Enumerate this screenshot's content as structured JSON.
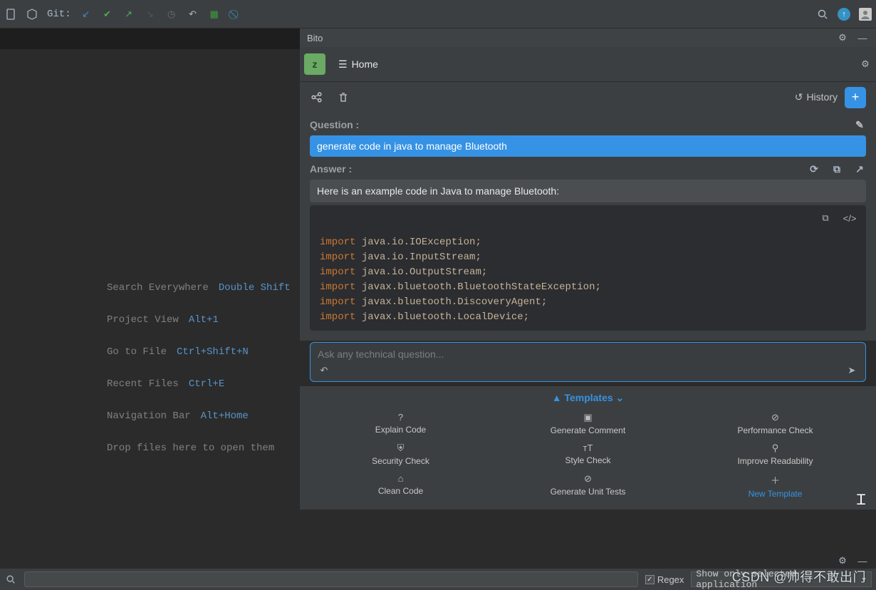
{
  "toolbar": {
    "git_label": "Git:"
  },
  "shortcuts": {
    "items": [
      {
        "label": "Search Everywhere",
        "key": "Double Shift"
      },
      {
        "label": "Project View",
        "key": "Alt+1"
      },
      {
        "label": "Go to File",
        "key": "Ctrl+Shift+N"
      },
      {
        "label": "Recent Files",
        "key": "Ctrl+E"
      },
      {
        "label": "Navigation Bar",
        "key": "Alt+Home"
      }
    ],
    "drop": "Drop files here to open them"
  },
  "bito": {
    "title": "Bito",
    "z": "z",
    "home": "Home",
    "history": "History",
    "question_hdr": "Question :",
    "question": "generate code in java to manage Bluetooth",
    "answer_hdr": "Answer :",
    "answer_intro": "Here is an example code in Java to manage Bluetooth:",
    "code": {
      "lines": [
        {
          "kw": "import",
          "rest": " java.io.IOException;"
        },
        {
          "kw": "import",
          "rest": " java.io.InputStream;"
        },
        {
          "kw": "import",
          "rest": " java.io.OutputStream;"
        },
        {
          "kw": "import",
          "rest": " javax.bluetooth.BluetoothStateException;"
        },
        {
          "kw": "import",
          "rest": " javax.bluetooth.DiscoveryAgent;"
        },
        {
          "kw": "import",
          "rest": " javax.bluetooth.LocalDevice;"
        }
      ]
    },
    "ask_placeholder": "Ask any technical question...",
    "templates_hdr": "Templates",
    "templates": [
      "Explain Code",
      "Generate Comment",
      "Performance Check",
      "Security Check",
      "Style Check",
      "Improve Readability",
      "Clean Code",
      "Generate Unit Tests",
      "New Template"
    ]
  },
  "bottom": {
    "regex": "Regex",
    "selector": "Show only selected application"
  },
  "watermark": "CSDN @帅得不敢出门"
}
